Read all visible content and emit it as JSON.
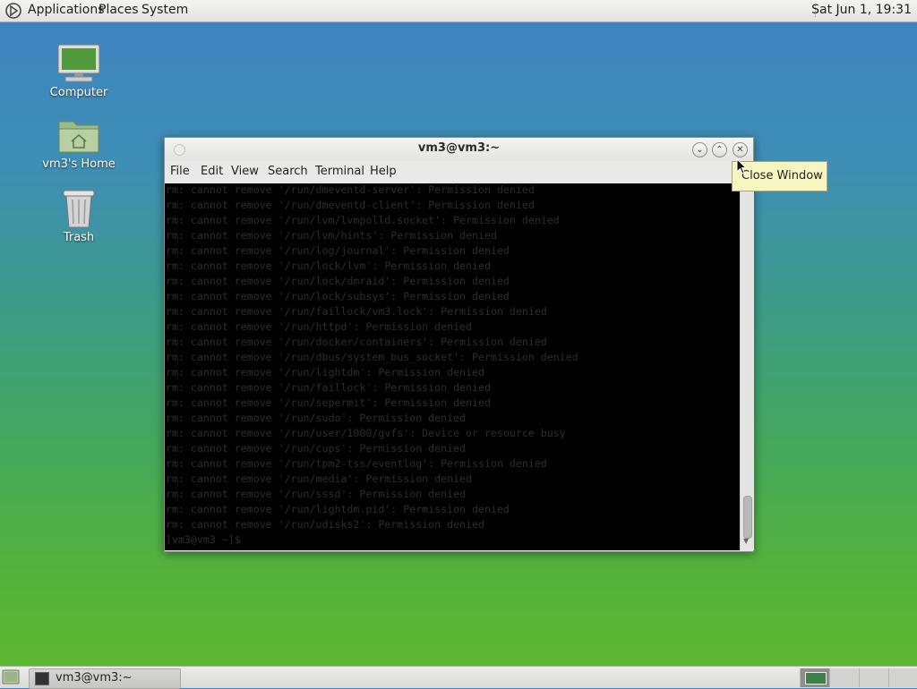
{
  "top_panel": {
    "menus": [
      "Applications",
      "Places",
      "System"
    ],
    "clock": "Sat Jun  1, 19:31"
  },
  "desktop_icons": [
    {
      "label": "Computer",
      "icon": "computer-icon"
    },
    {
      "label": "vm3's Home",
      "icon": "home-folder-icon"
    },
    {
      "label": "Trash",
      "icon": "trash-icon"
    }
  ],
  "terminal": {
    "title": "vm3@vm3:~",
    "menu": [
      "File",
      "Edit",
      "View",
      "Search",
      "Terminal",
      "Help"
    ],
    "lines": [
      "rm: cannot remove '/run/dmeventd-server': Permission denied",
      "rm: cannot remove '/run/dmeventd-client': Permission denied",
      "rm: cannot remove '/run/lvm/lvmpolld.socket': Permission denied",
      "rm: cannot remove '/run/lvm/hints': Permission denied",
      "rm: cannot remove '/run/log/journal': Permission denied",
      "rm: cannot remove '/run/lock/lvm': Permission denied",
      "rm: cannot remove '/run/lock/dmraid': Permission denied",
      "rm: cannot remove '/run/lock/subsys': Permission denied",
      "rm: cannot remove '/run/faillock/vm3.lock': Permission denied",
      "rm: cannot remove '/run/httpd': Permission denied",
      "rm: cannot remove '/run/docker/containers': Permission denied",
      "rm: cannot remove '/run/dbus/system_bus_socket': Permission denied",
      "rm: cannot remove '/run/lightdm': Permission denied",
      "rm: cannot remove '/run/faillock': Permission denied",
      "rm: cannot remove '/run/sepermit': Permission denied",
      "rm: cannot remove '/run/sudo': Permission denied",
      "rm: cannot remove '/run/user/1000/gvfs': Device or resource busy",
      "rm: cannot remove '/run/cups': Permission denied",
      "rm: cannot remove '/run/tpm2-tss/eventlog': Permission denied",
      "rm: cannot remove '/run/media': Permission denied",
      "rm: cannot remove '/run/sssd': Permission denied",
      "rm: cannot remove '/run/lightdm.pid': Permission denied",
      "rm: cannot remove '/run/udisks2': Permission denied",
      "[vm3@vm3 ~]$ "
    ]
  },
  "tooltip": "Close Window",
  "taskbar": {
    "window_label": "vm3@vm3:~"
  },
  "colors": {
    "terminal_bg": "#000000",
    "terminal_text": "#2d2d2d",
    "tooltip_bg": "#f8f6c0"
  }
}
